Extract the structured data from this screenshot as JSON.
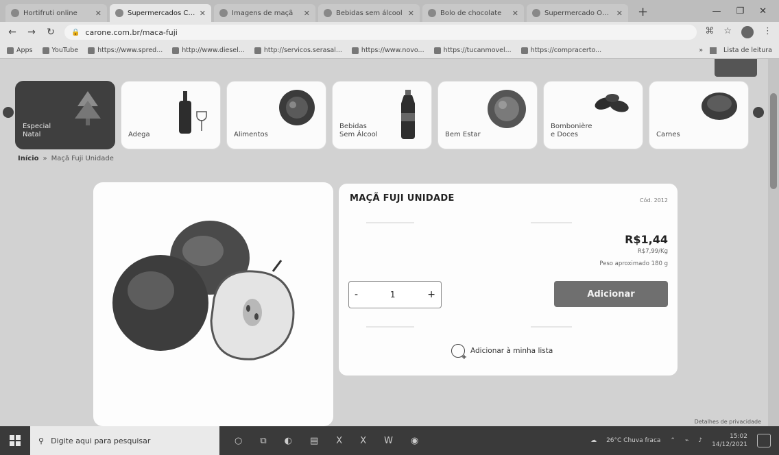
{
  "browser": {
    "tabs": [
      {
        "title": "Hortifruti online"
      },
      {
        "title": "Supermercados Caro",
        "active": true
      },
      {
        "title": "Imagens de maçã"
      },
      {
        "title": "Bebidas sem álcool"
      },
      {
        "title": "Bolo de chocolate"
      },
      {
        "title": "Supermercado Online"
      }
    ],
    "address": "carone.com.br/maca-fuji",
    "bookmarks": [
      "Apps",
      "YouTube",
      "https://www.spred...",
      "http://www.diesel...",
      "http://servicos.serasal...",
      "https://www.novo...",
      "https://tucanmovel...",
      "https://compracerto..."
    ],
    "reading_list": "Lista de leitura"
  },
  "categories": [
    {
      "label": "Especial\nNatal",
      "icon": "christmas-tree-icon",
      "active": true
    },
    {
      "label": "Adega",
      "icon": "wine-bottle-icon"
    },
    {
      "label": "Alimentos",
      "icon": "food-bowl-icon"
    },
    {
      "label": "Bebidas\nSem Álcool",
      "icon": "soda-bottle-icon"
    },
    {
      "label": "Bem Estar",
      "icon": "wellness-icon"
    },
    {
      "label": "Bombonière\ne Doces",
      "icon": "chocolate-icon"
    },
    {
      "label": "Carnes",
      "icon": "meat-icon"
    }
  ],
  "breadcrumb": {
    "home": "Início",
    "separator": "»",
    "current": "Maçã Fuji Unidade"
  },
  "product": {
    "name": "MAÇÃ FUJI UNIDADE",
    "sku": "Cód. 2012",
    "price": "R$1,44",
    "price_per_kg": "R$7,99/Kg",
    "approx_weight": "Peso aproximado 180 g",
    "quantity": "1",
    "minus": "-",
    "plus": "+",
    "add_button": "Adicionar",
    "add_to_list": "Adicionar à minha lista"
  },
  "cookie_notice": "Detalhes de privacidade",
  "taskbar": {
    "search_placeholder": "Digite aqui para pesquisar",
    "weather": "26°C  Chuva fraca",
    "time": "15:02",
    "date": "14/12/2021"
  }
}
